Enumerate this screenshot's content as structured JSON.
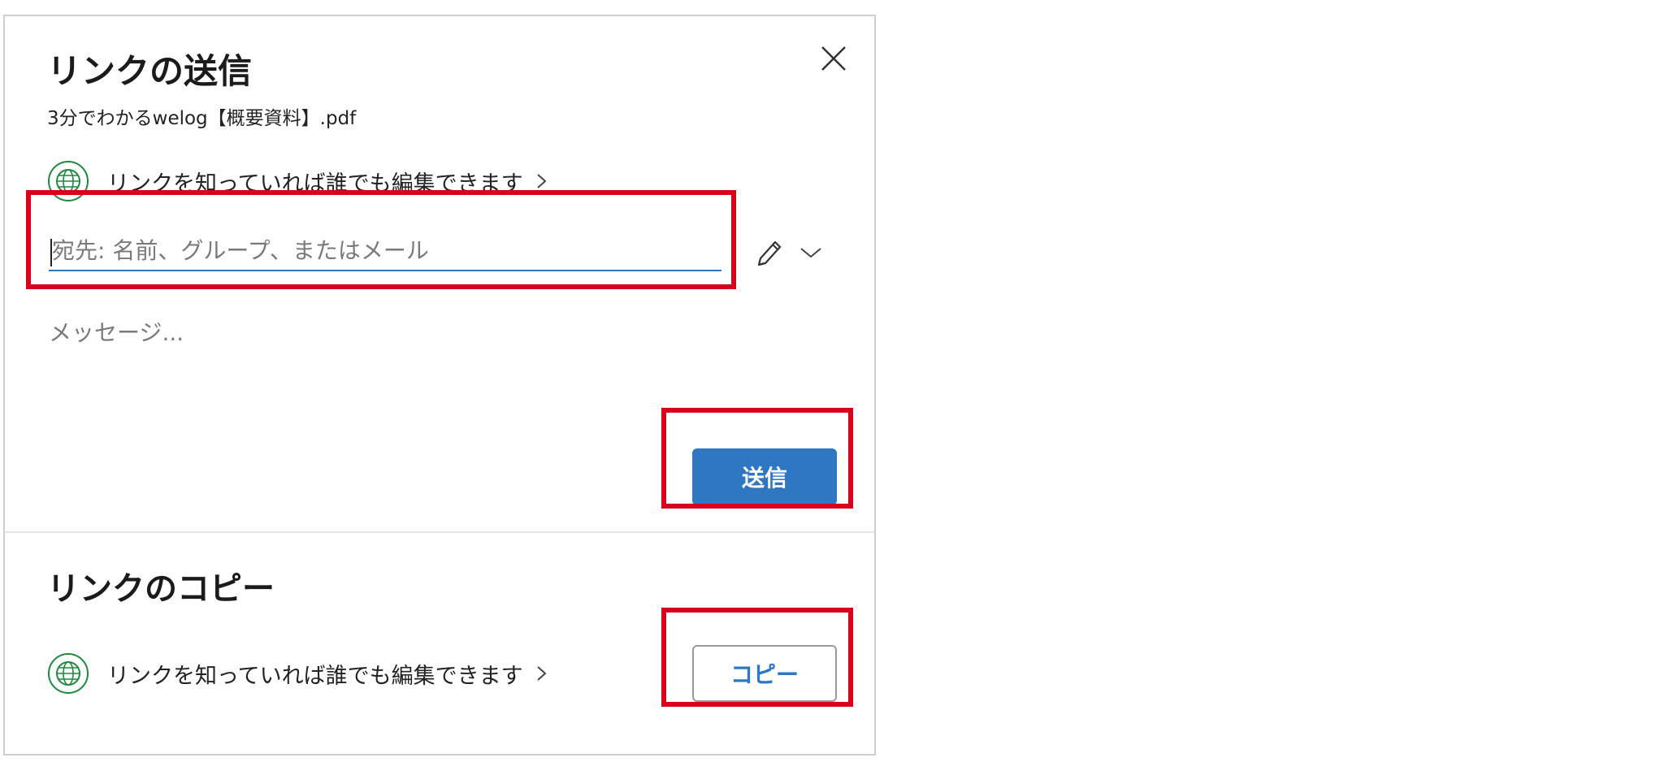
{
  "dialog": {
    "title": "リンクの送信",
    "file_name": "3分でわかるwelog【概要資料】.pdf",
    "permission_text": "リンクを知っていれば誰でも編集できます",
    "to_placeholder": "宛先: 名前、グループ、またはメール",
    "message_placeholder": "メッセージ...",
    "send_label": "送信"
  },
  "copy_section": {
    "title": "リンクのコピー",
    "permission_text": "リンクを知っていれば誰でも編集できます",
    "copy_label": "コピー"
  },
  "icons": {
    "close": "close-icon",
    "globe": "globe-icon",
    "chevron_right": "chevron-right-icon",
    "pencil": "pencil-icon",
    "chevron_down": "chevron-down-icon"
  },
  "colors": {
    "accent": "#2f77c2",
    "globe_green": "#1e8a3e",
    "highlight_red": "#d9001b"
  }
}
